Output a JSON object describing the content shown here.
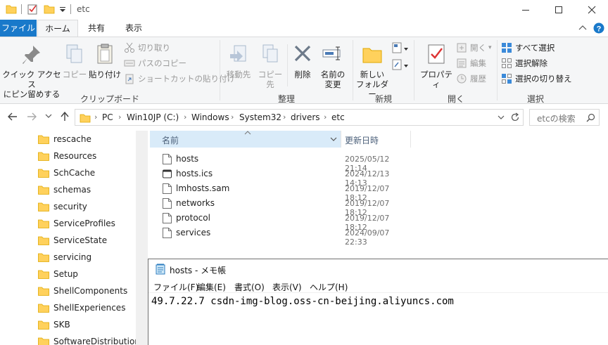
{
  "window": {
    "title": "etc"
  },
  "tabs": {
    "file": "ファイル",
    "home": "ホーム",
    "share": "共有",
    "view": "表示"
  },
  "ribbon": {
    "clipboard": {
      "label": "クリップボード",
      "pin_line1": "クイック アクセス",
      "pin_line2": "にピン留めする",
      "copy": "コピー",
      "paste": "貼り付け",
      "cut": "切り取り",
      "copy_path": "パスのコピー",
      "paste_shortcut": "ショートカットの貼り付け"
    },
    "organize": {
      "label": "整理",
      "move_to": "移動先",
      "copy_to": "コピー先",
      "delete": "削除",
      "rename_line1": "名前の",
      "rename_line2": "変更"
    },
    "new": {
      "label": "新規",
      "new_folder_line1": "新しい",
      "new_folder_line2": "フォルダー"
    },
    "open": {
      "label": "開く",
      "properties": "プロパティ",
      "open": "開く",
      "edit": "編集",
      "history": "履歴"
    },
    "select": {
      "label": "選択",
      "select_all": "すべて選択",
      "select_none": "選択解除",
      "invert": "選択の切り替え"
    }
  },
  "address": {
    "crumbs": [
      "PC",
      "Win10JP (C:)",
      "Windows",
      "System32",
      "drivers",
      "etc"
    ],
    "search_placeholder": "etcの検索"
  },
  "sidebar": {
    "items": [
      "rescache",
      "Resources",
      "SchCache",
      "schemas",
      "security",
      "ServiceProfiles",
      "ServiceState",
      "servicing",
      "Setup",
      "ShellComponents",
      "ShellExperiences",
      "SKB",
      "SoftwareDistribution"
    ]
  },
  "filelist": {
    "col_name": "名前",
    "col_date": "更新日時",
    "files": [
      {
        "name": "hosts",
        "date": "2025/05/12 21:14",
        "icon": "file-icon"
      },
      {
        "name": "hosts.ics",
        "date": "2024/12/13 14:13",
        "icon": "ics-file-icon"
      },
      {
        "name": "lmhosts.sam",
        "date": "2019/12/07 18:12",
        "icon": "file-icon"
      },
      {
        "name": "networks",
        "date": "2019/12/07 18:12",
        "icon": "file-icon"
      },
      {
        "name": "protocol",
        "date": "2019/12/07 18:12",
        "icon": "file-icon"
      },
      {
        "name": "services",
        "date": "2024/09/07 22:33",
        "icon": "file-icon"
      }
    ]
  },
  "notepad": {
    "title": "hosts - メモ帳",
    "menu": [
      "ファイル(F)",
      "編集(E)",
      "書式(O)",
      "表示(V)",
      "ヘルプ(H)"
    ],
    "content": "49.7.22.7 csdn-img-blog.oss-cn-beijing.aliyuncs.com"
  },
  "colors": {
    "accent": "#1979ca",
    "folder": "#ffd15c",
    "selected_header": "#d9ebf9"
  }
}
